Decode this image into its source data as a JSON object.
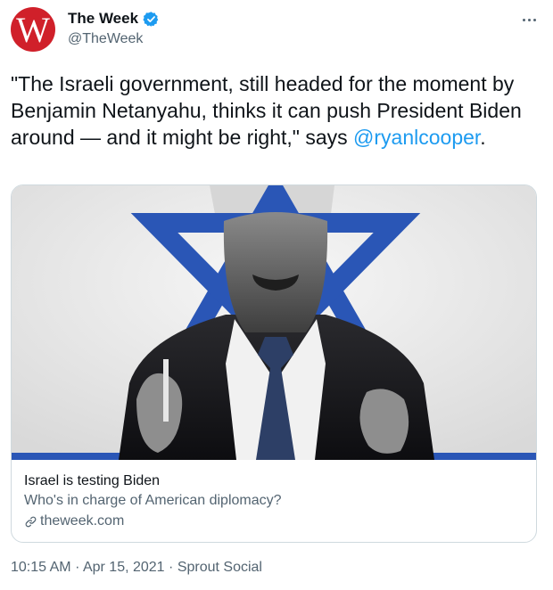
{
  "tweet": {
    "avatar_letter": "W",
    "display_name": "The Week",
    "handle": "@TheWeek",
    "text_before_mention": "\"The Israeli government, still headed for the moment by Benjamin Netanyahu, thinks it can push President Biden around — and it might be right,\" says ",
    "mention": "@ryanlcooper",
    "text_after_mention": "."
  },
  "card": {
    "title": "Israel is testing Biden",
    "description": "Who's in charge of American diplomacy?",
    "domain": "theweek.com"
  },
  "footer": {
    "time": "10:15 AM",
    "separator": "·",
    "date": "Apr 15, 2021",
    "source": "Sprout Social"
  },
  "icons": {
    "verified": "verified-badge-icon",
    "more": "more-options-icon",
    "link": "link-icon"
  },
  "colors": {
    "brand_red": "#d0202a",
    "link_blue": "#1d9bf0",
    "star_blue": "#2a56b6",
    "secondary_text": "#536471"
  }
}
